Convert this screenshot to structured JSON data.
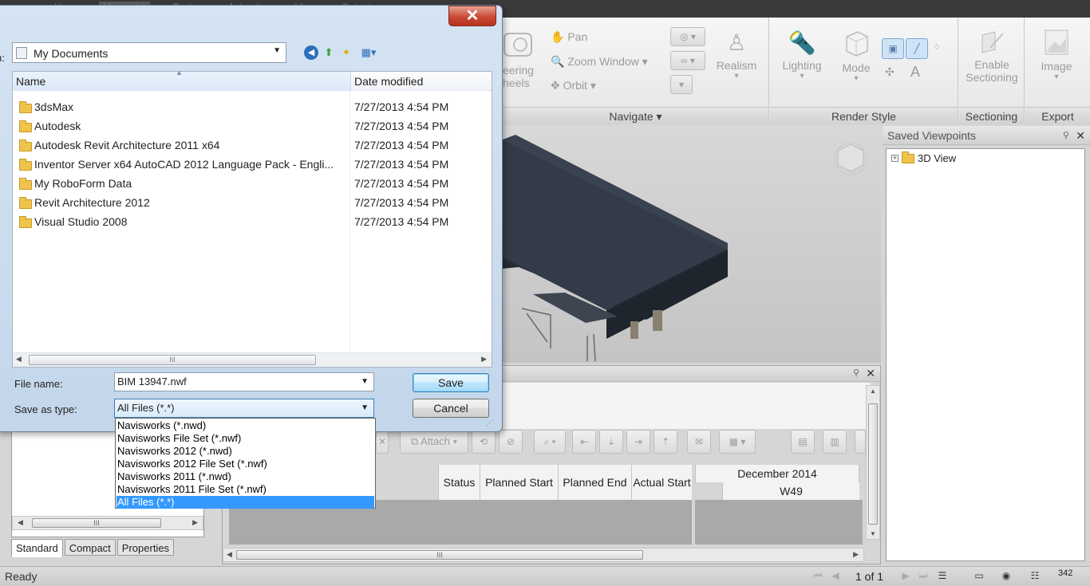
{
  "topbar": {
    "tabs": [
      "Home",
      "Viewpoint",
      "Review",
      "Animation",
      "View",
      "Output"
    ]
  },
  "ribbon": {
    "navigate": {
      "label": "Navigate",
      "steering_label": "eering",
      "wheels_label": "heels",
      "pan": "Pan",
      "zoom_window": "Zoom Window",
      "orbit": "Orbit",
      "realism": "Realism"
    },
    "render_style": {
      "label": "Render Style",
      "lighting": "Lighting",
      "mode": "Mode"
    },
    "sectioning": {
      "label": "Sectioning",
      "enable": "Enable",
      "sectioning_text": "Sectioning"
    },
    "export": {
      "label": "Export",
      "image": "Image"
    }
  },
  "saved_viewpoints": {
    "title": "Saved Viewpoints",
    "items": [
      "3D View"
    ]
  },
  "timeliner": {
    "toolbar_attach": "Attach",
    "columns": [
      "Status",
      "Planned Start",
      "Planned End",
      "Actual Start"
    ],
    "gantt_month": "December 2014",
    "gantt_week": "W49"
  },
  "left_panel": {
    "tabs": [
      "Standard",
      "Compact",
      "Properties"
    ]
  },
  "status_bar": {
    "ready": "Ready",
    "page": "1 of 1",
    "memory": "342"
  },
  "dialog": {
    "location_label": "n:",
    "location": "My Documents",
    "columns": {
      "name": "Name",
      "date": "Date modified"
    },
    "files": [
      {
        "name": "3dsMax",
        "date": "7/27/2013 4:54 PM"
      },
      {
        "name": "Autodesk",
        "date": "7/27/2013 4:54 PM"
      },
      {
        "name": "Autodesk Revit Architecture 2011 x64",
        "date": "7/27/2013 4:54 PM"
      },
      {
        "name": "Inventor Server x64 AutoCAD 2012 Language Pack - Engli...",
        "date": "7/27/2013 4:54 PM"
      },
      {
        "name": "My RoboForm Data",
        "date": "7/27/2013 4:54 PM"
      },
      {
        "name": "Revit Architecture 2012",
        "date": "7/27/2013 4:54 PM"
      },
      {
        "name": "Visual Studio 2008",
        "date": "7/27/2013 4:54 PM"
      }
    ],
    "file_name_label": "File name:",
    "file_name": "BIM 13947.nwf",
    "save_as_type_label": "Save as type:",
    "save_as_type": "All Files (*.*)",
    "save_button": "Save",
    "cancel_button": "Cancel",
    "type_options": [
      "Navisworks (*.nwd)",
      "Navisworks File Set (*.nwf)",
      "Navisworks 2012 (*.nwd)",
      "Navisworks 2012 File Set (*.nwf)",
      "Navisworks 2011 (*.nwd)",
      "Navisworks 2011 File Set (*.nwf)",
      "All Files (*.*)"
    ],
    "selected_type_index": 6,
    "colors": {
      "selection": "#3399ff",
      "close_button": "#c94a35"
    }
  }
}
